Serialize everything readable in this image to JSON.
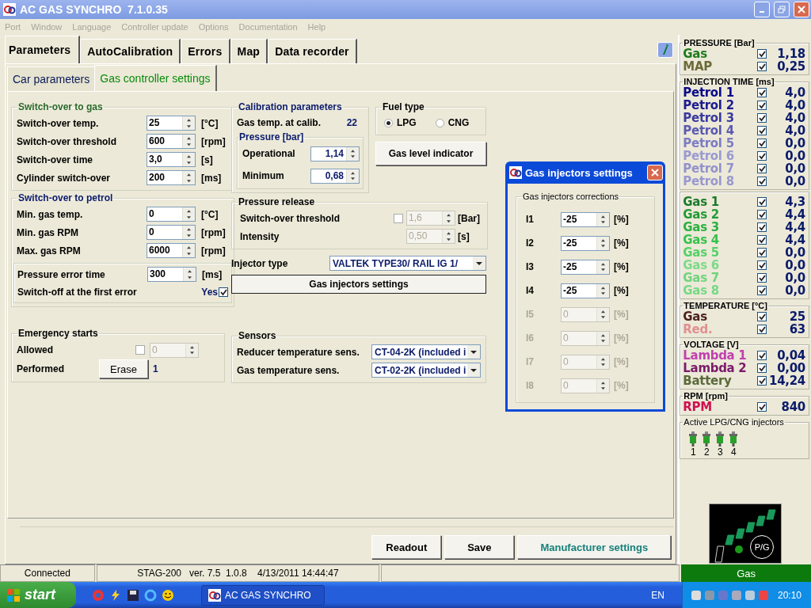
{
  "window": {
    "title": "AC GAS SYNCHRO  7.1.0.35"
  },
  "menu": [
    {
      "label": "Port",
      "disabled": true
    },
    {
      "label": "Window",
      "disabled": true
    },
    {
      "label": "Language",
      "disabled": true
    },
    {
      "label": "Controller update",
      "disabled": true
    },
    {
      "label": "Options",
      "disabled": true
    },
    {
      "label": "Documentation",
      "disabled": true
    },
    {
      "label": "Help",
      "disabled": true
    }
  ],
  "tabs": [
    {
      "label": "Parameters",
      "selected": true
    },
    {
      "label": "AutoCalibration",
      "selected": false
    },
    {
      "label": "Errors",
      "selected": false
    },
    {
      "label": "Map",
      "selected": false
    },
    {
      "label": "Data recorder",
      "selected": false
    }
  ],
  "subtabs": [
    {
      "label": "Car parameters",
      "selected": false
    },
    {
      "label": "Gas controller settings",
      "selected": true
    }
  ],
  "switch_to_gas": {
    "title": "Switch-over to gas",
    "fields": [
      {
        "label": "Switch-over temp.",
        "value": "25",
        "unit": "[°C]"
      },
      {
        "label": "Switch-over threshold",
        "value": "600",
        "unit": "[rpm]"
      },
      {
        "label": "Switch-over time",
        "value": "3,0",
        "unit": "[s]"
      },
      {
        "label": "Cylinder switch-over",
        "value": "200",
        "unit": "[ms]"
      }
    ]
  },
  "switch_to_petrol": {
    "title": "Switch-over to petrol",
    "fields": [
      {
        "label": "Min. gas temp.",
        "value": "0",
        "unit": "[°C]"
      },
      {
        "label": "Min. gas RPM",
        "value": "0",
        "unit": "[rpm]"
      },
      {
        "label": "Max. gas RPM",
        "value": "6000",
        "unit": "[rpm]"
      }
    ],
    "error_time": {
      "label": "Pressure error time",
      "value": "300",
      "unit": "[ms]"
    },
    "switch_off": {
      "label": "Switch-off at the first error",
      "option": "Yes",
      "checked": true
    }
  },
  "emergency": {
    "title": "Emergency starts",
    "allowed": {
      "label": "Allowed",
      "checked": false,
      "value": "0",
      "disabled": true
    },
    "performed": {
      "label": "Performed",
      "button": "Erase",
      "count": "1"
    }
  },
  "calibration": {
    "title": "Calibration parameters",
    "gas_temp": {
      "label": "Gas temp. at calib.",
      "value": "22"
    },
    "pressure": {
      "title": "Pressure [bar]",
      "fields": [
        {
          "label": "Operational",
          "value": "1,14"
        },
        {
          "label": "Minimum",
          "value": "0,68"
        }
      ]
    }
  },
  "fuel_type": {
    "title": "Fuel type",
    "options": [
      {
        "label": "LPG",
        "selected": true
      },
      {
        "label": "CNG",
        "selected": false
      }
    ]
  },
  "gas_level_button": "Gas level indicator",
  "pressure_release": {
    "title": "Pressure release",
    "rows": [
      {
        "kind": "checkbox",
        "label": "Switch-over threshold",
        "checked": false,
        "value": "1,6",
        "unit": "[Bar]",
        "disabled": true
      },
      {
        "kind": "plain",
        "label": "Intensity",
        "value": "0,50",
        "unit": "[s]",
        "disabled": true
      }
    ]
  },
  "injector_type": {
    "label": "Injector type",
    "value": "VALTEK TYPE30/ RAIL IG 1/"
  },
  "injectors_button": "Gas injectors settings",
  "sensors": {
    "title": "Sensors",
    "rows": [
      {
        "label": "Reducer temperature sens.",
        "value": "CT-04-2K (included i"
      },
      {
        "label": "Gas temperature sens.",
        "value": "CT-02-2K (included i"
      }
    ]
  },
  "buttons": [
    {
      "label": "Readout",
      "kind": "normal"
    },
    {
      "label": "Save",
      "kind": "normal"
    },
    {
      "label": "Manufacturer settings",
      "kind": "accent"
    }
  ],
  "status_bar": [
    "Connected",
    "STAG-200   ver. 7.5  1.0.8    4/13/2011 14:44:47"
  ],
  "dialog": {
    "title": "Gas injectors settings",
    "group": "Gas injectors corrections",
    "rows": [
      {
        "label": "I1",
        "value": "-25",
        "unit": "[%]",
        "disabled": false
      },
      {
        "label": "I2",
        "value": "-25",
        "unit": "[%]",
        "disabled": false
      },
      {
        "label": "I3",
        "value": "-25",
        "unit": "[%]",
        "disabled": false
      },
      {
        "label": "I4",
        "value": "-25",
        "unit": "[%]",
        "disabled": false
      },
      {
        "label": "I5",
        "value": "0",
        "unit": "[%]",
        "disabled": true
      },
      {
        "label": "I6",
        "value": "0",
        "unit": "[%]",
        "disabled": true
      },
      {
        "label": "I7",
        "value": "0",
        "unit": "[%]",
        "disabled": true
      },
      {
        "label": "I8",
        "value": "0",
        "unit": "[%]",
        "disabled": true
      }
    ]
  },
  "sidebar": {
    "groups": [
      {
        "title": "PRESSURE [Bar]",
        "rows": [
          {
            "label": "Gas",
            "color": "#1e7b1e",
            "checked": true,
            "value": "1,18"
          },
          {
            "label": "MAP",
            "color": "#6b6b3a",
            "checked": true,
            "value": "0,25"
          }
        ]
      },
      {
        "title": "INJECTION TIME [ms]",
        "rows": [
          {
            "label": "Petrol 1",
            "color": "#0a0a8a",
            "checked": true,
            "value": "4,0"
          },
          {
            "label": "Petrol 2",
            "color": "#1d1d90",
            "checked": true,
            "value": "4,0"
          },
          {
            "label": "Petrol 3",
            "color": "#3a3aa0",
            "checked": true,
            "value": "4,0"
          },
          {
            "label": "Petrol 4",
            "color": "#5a5ab0",
            "checked": true,
            "value": "4,0"
          },
          {
            "label": "Petrol 5",
            "color": "#7c7cc4",
            "checked": true,
            "value": "0,0"
          },
          {
            "label": "Petrol 6",
            "color": "#9a9ad2",
            "checked": true,
            "value": "0,0"
          },
          {
            "label": "Petrol 7",
            "color": "#9292cc",
            "checked": true,
            "value": "0,0"
          },
          {
            "label": "Petrol 8",
            "color": "#9898d0",
            "checked": true,
            "value": "0,0"
          }
        ]
      },
      {
        "rows": [
          {
            "label": "Gas 1",
            "color": "#1a7a2a",
            "checked": true,
            "value": "4,3"
          },
          {
            "label": "Gas 2",
            "color": "#229a35",
            "checked": true,
            "value": "4,4"
          },
          {
            "label": "Gas 3",
            "color": "#2bb040",
            "checked": true,
            "value": "4,4"
          },
          {
            "label": "Gas 4",
            "color": "#35c24c",
            "checked": true,
            "value": "4,4"
          },
          {
            "label": "Gas 5",
            "color": "#55d068",
            "checked": true,
            "value": "0,0"
          },
          {
            "label": "Gas 6",
            "color": "#7cda88",
            "checked": true,
            "value": "0,0"
          },
          {
            "label": "Gas 7",
            "color": "#6ed47c",
            "checked": true,
            "value": "0,0"
          },
          {
            "label": "Gas 8",
            "color": "#78d886",
            "checked": true,
            "value": "0,0"
          }
        ]
      },
      {
        "title": "TEMPERATURE [°C]",
        "rows": [
          {
            "label": "Gas",
            "color": "#4a1f1f",
            "checked": true,
            "value": "25"
          },
          {
            "label": "Red.",
            "color": "#e09090",
            "checked": true,
            "value": "63"
          }
        ]
      },
      {
        "title": "VOLTAGE [V]",
        "rows": [
          {
            "label": "Lambda 1",
            "color": "#c040b0",
            "checked": true,
            "value": "0,04"
          },
          {
            "label": "Lambda 2",
            "color": "#7a1a6a",
            "checked": true,
            "value": "0,00"
          },
          {
            "label": "Battery",
            "color": "#5a6a3a",
            "checked": true,
            "value": "14,24"
          }
        ]
      },
      {
        "title": "RPM [rpm]",
        "rows": [
          {
            "label": "RPM",
            "color": "#d01050",
            "checked": true,
            "value": "840"
          }
        ]
      }
    ],
    "injectors": {
      "title": "Active LPG/CNG injectors",
      "items": [
        "1",
        "2",
        "3",
        "4"
      ]
    },
    "gas_indicator": {
      "label": "P/G"
    },
    "mode": "Gas"
  },
  "taskbar": {
    "start": "start",
    "task": "AC GAS SYNCHRO",
    "language": "EN",
    "clock": "20:10"
  }
}
